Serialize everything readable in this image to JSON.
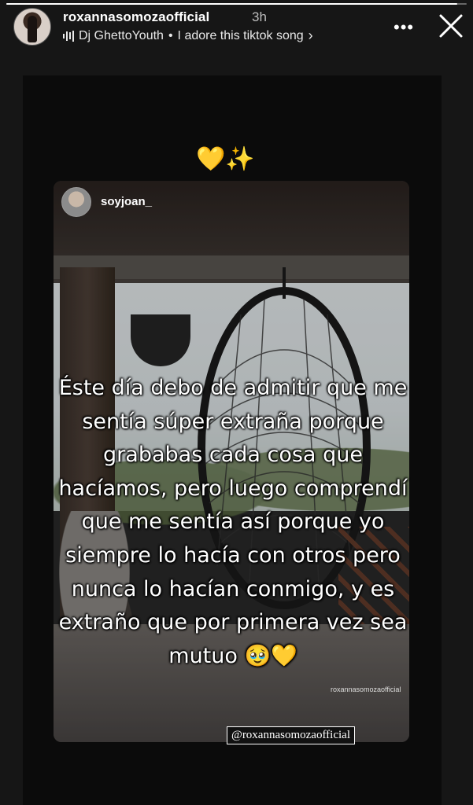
{
  "story": {
    "username": "roxannasomozaofficial",
    "time": "3h",
    "progress": 0.98,
    "music": {
      "artist": "Dj GhettoYouth",
      "separator": "•",
      "song": "I adore this tiktok song",
      "chevron": "›"
    },
    "more_label": "•••"
  },
  "reel": {
    "username": "soyjoan_",
    "top_emoji": "💛✨",
    "caption": "Éste día debo de admitir que me sentía súper extraña porque grababas cada cosa que hacíamos, pero luego comprendí que me sentía así porque yo siempre lo hacía con otros pero nunca lo hacían conmigo, y es extraño que por primera vez sea mutuo 🥹💛",
    "watermark": "roxannasomozaofficial",
    "mention": "@roxannasomozaofficial"
  },
  "icons": {
    "music": "music-bars-icon",
    "more": "more-icon",
    "close": "close-icon"
  }
}
